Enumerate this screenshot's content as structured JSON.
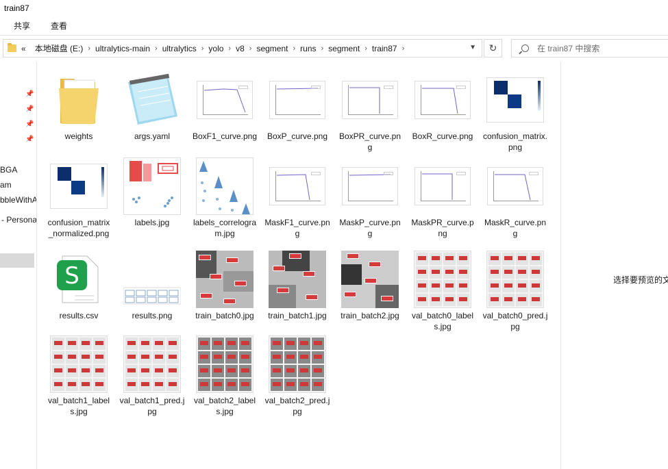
{
  "window": {
    "title": "train87"
  },
  "ribbon": {
    "tabs": [
      "共享",
      "查看"
    ]
  },
  "address": {
    "prefix": "«",
    "crumbs": [
      "本地磁盘 (E:)",
      "ultralytics-main",
      "ultralytics",
      "yolo",
      "v8",
      "segment",
      "runs",
      "segment",
      "train87"
    ]
  },
  "search": {
    "placeholder": "在 train87 中搜索"
  },
  "nav": {
    "items": [
      "BGA",
      "am",
      "bbleWithA",
      "- Persona"
    ]
  },
  "files": [
    {
      "name": "weights",
      "kind": "folder"
    },
    {
      "name": "args.yaml",
      "kind": "notepad"
    },
    {
      "name": "BoxF1_curve.png",
      "kind": "plot"
    },
    {
      "name": "BoxP_curve.png",
      "kind": "plot"
    },
    {
      "name": "BoxPR_curve.png",
      "kind": "plot"
    },
    {
      "name": "BoxR_curve.png",
      "kind": "plot"
    },
    {
      "name": "confusion_matrix.png",
      "kind": "conf"
    },
    {
      "name": "confusion_matrix_normalized.png",
      "kind": "conf"
    },
    {
      "name": "labels.jpg",
      "kind": "labels"
    },
    {
      "name": "labels_correlogram.jpg",
      "kind": "correlogram"
    },
    {
      "name": "MaskF1_curve.png",
      "kind": "plot"
    },
    {
      "name": "MaskP_curve.png",
      "kind": "plot"
    },
    {
      "name": "MaskPR_curve.png",
      "kind": "plot"
    },
    {
      "name": "MaskR_curve.png",
      "kind": "plot"
    },
    {
      "name": "results.csv",
      "kind": "csv"
    },
    {
      "name": "results.png",
      "kind": "resultsplot"
    },
    {
      "name": "train_batch0.jpg",
      "kind": "mosaic"
    },
    {
      "name": "train_batch1.jpg",
      "kind": "mosaic"
    },
    {
      "name": "train_batch2.jpg",
      "kind": "mosaic"
    },
    {
      "name": "val_batch0_labels.jpg",
      "kind": "grid"
    },
    {
      "name": "val_batch0_pred.jpg",
      "kind": "grid"
    },
    {
      "name": "val_batch1_labels.jpg",
      "kind": "grid"
    },
    {
      "name": "val_batch1_pred.jpg",
      "kind": "grid"
    },
    {
      "name": "val_batch2_labels.jpg",
      "kind": "griddark"
    },
    {
      "name": "val_batch2_pred.jpg",
      "kind": "griddark"
    }
  ],
  "preview": {
    "message": "选择要预览的文件"
  }
}
